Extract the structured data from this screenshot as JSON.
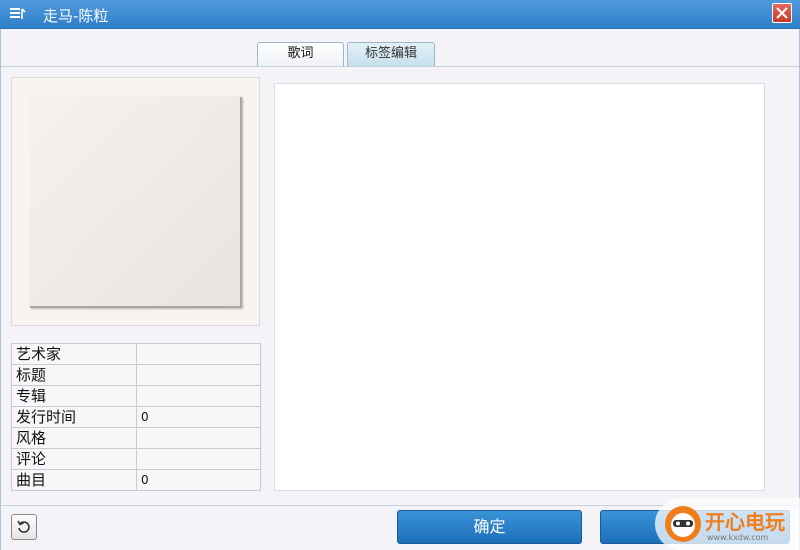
{
  "window": {
    "title": "走马-陈粒"
  },
  "tabs": [
    {
      "label": "歌词",
      "active": true
    },
    {
      "label": "标签编辑",
      "active": false
    }
  ],
  "info": [
    {
      "key": "艺术家",
      "value": ""
    },
    {
      "key": "标题",
      "value": ""
    },
    {
      "key": "专辑",
      "value": ""
    },
    {
      "key": "发行时间",
      "value": "0"
    },
    {
      "key": "风格",
      "value": ""
    },
    {
      "key": "评论",
      "value": ""
    },
    {
      "key": "曲目",
      "value": "0"
    }
  ],
  "lyrics": {
    "text": ""
  },
  "buttons": {
    "ok": "确定",
    "cancel": ""
  },
  "watermark": {
    "brand": "开心电玩",
    "site": "www.kxdw.com"
  },
  "icons": {
    "menu": "menu-icon",
    "close": "close-icon",
    "reset": "undo-icon",
    "logo": "mascot-logo-icon"
  },
  "colors": {
    "titlebar": "#3a8ad4",
    "button": "#2a80c8",
    "close": "#d84a3a"
  }
}
